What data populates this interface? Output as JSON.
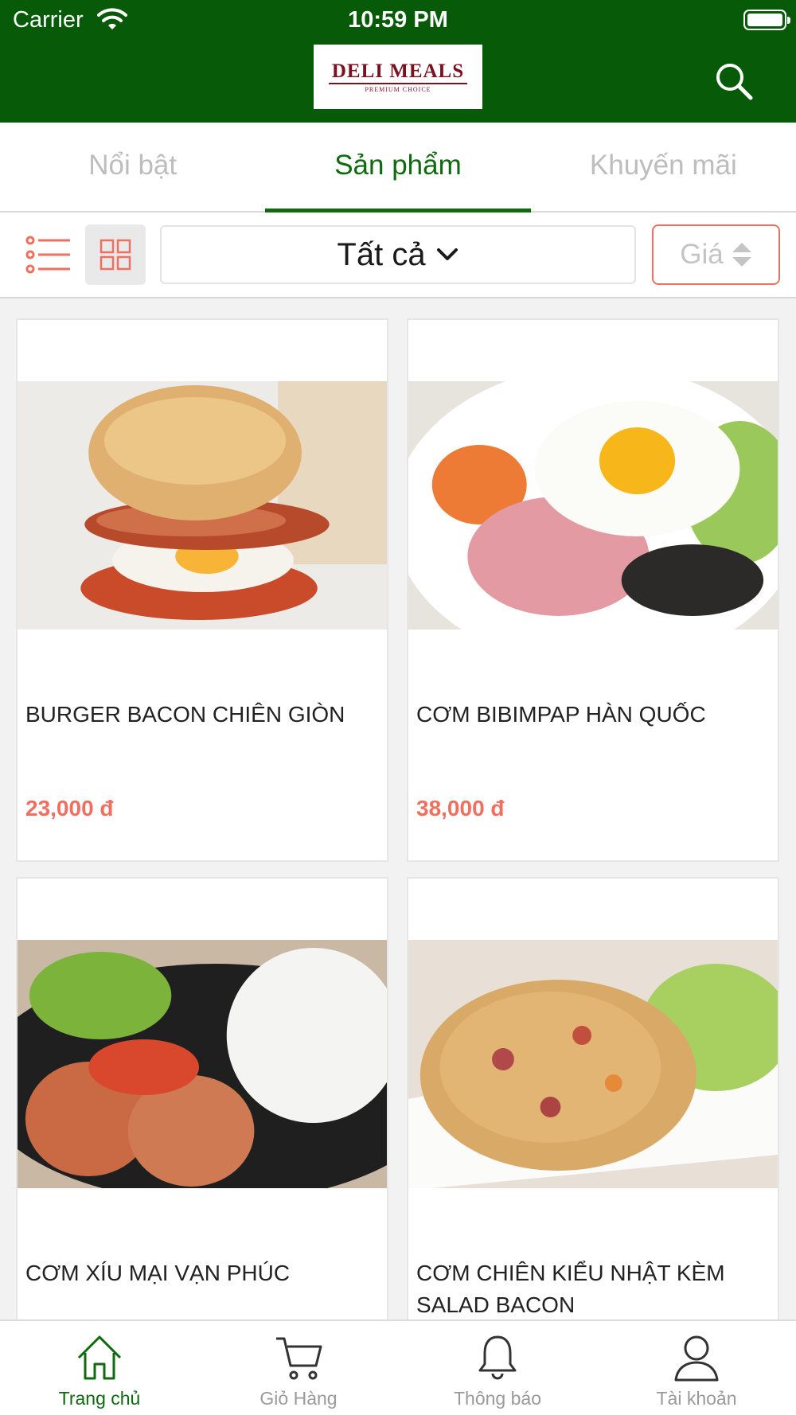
{
  "status_bar": {
    "carrier": "Carrier",
    "time": "10:59 PM"
  },
  "header": {
    "logo_text": "DELI MEALS",
    "logo_subtext": "PREMIUM CHOICE",
    "search_icon": "search-icon"
  },
  "tabs": [
    {
      "label": "Nổi bật",
      "active": false
    },
    {
      "label": "Sản phẩm",
      "active": true
    },
    {
      "label": "Khuyến mãi",
      "active": false
    }
  ],
  "filter": {
    "view_mode": "grid",
    "category": "Tất cả",
    "price_sort_label": "Giá"
  },
  "products": [
    {
      "name": "BURGER BACON CHIÊN GIÒN",
      "price": "23,000 đ"
    },
    {
      "name": "CƠM BIBIMPAP HÀN QUỐC",
      "price": "38,000 đ"
    },
    {
      "name": "CƠM XÍU MẠI VẠN PHÚC",
      "price": ""
    },
    {
      "name": "CƠM CHIÊN KIỂU NHẬT KÈM SALAD BACON",
      "price": ""
    }
  ],
  "bottom_nav": [
    {
      "label": "Trang chủ",
      "icon": "home-icon",
      "active": true
    },
    {
      "label": "Giỏ Hàng",
      "icon": "cart-icon",
      "active": false
    },
    {
      "label": "Thông báo",
      "icon": "bell-icon",
      "active": false
    },
    {
      "label": "Tài khoản",
      "icon": "user-icon",
      "active": false
    }
  ],
  "colors": {
    "primary_green": "#075a07",
    "accent_coral": "#f07060"
  }
}
